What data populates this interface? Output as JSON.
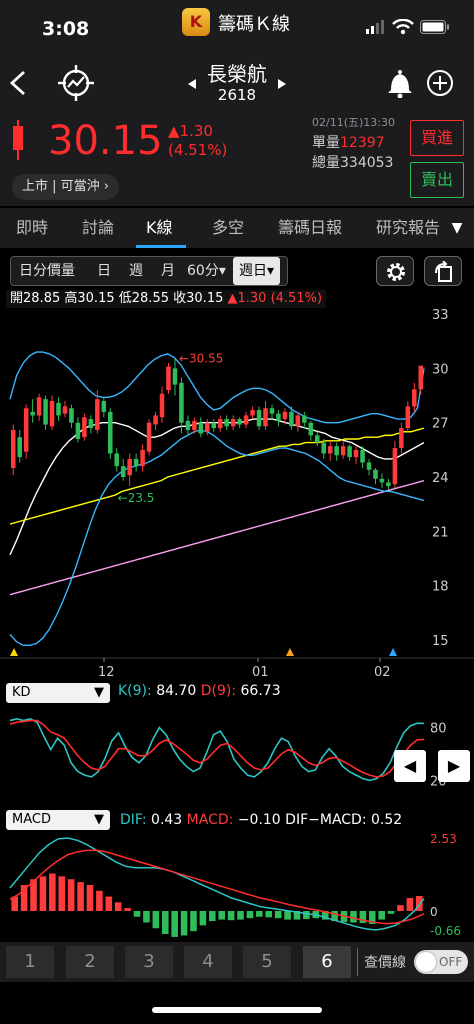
{
  "status_bar": {
    "time": "3:08",
    "app_logo": "K",
    "app_name": "籌碼Ｋ線"
  },
  "header": {
    "stock_name": "長榮航",
    "stock_code": "2618"
  },
  "quote": {
    "price": "30.15",
    "change": "▲1.30",
    "change_pct": "(4.51%)",
    "datetime": "02/11(五)13:30",
    "unit_volume_label": "單量",
    "unit_volume": "12397",
    "total_volume_label": "總量",
    "total_volume": "334053",
    "market_tag": "上市 | 可當沖 ›",
    "buy_label": "買進",
    "sell_label": "賣出"
  },
  "tabs": [
    "即時",
    "討論",
    "K線",
    "多空",
    "籌碼日報",
    "研究報告"
  ],
  "toolbar": {
    "items": [
      "日分價量",
      "日",
      "週",
      "月",
      "60分▾"
    ],
    "selected": "週日▾"
  },
  "ohlc": {
    "open_label": "開",
    "open": "28.85",
    "high_label": "高",
    "high": "30.15",
    "low_label": "低",
    "low": "28.55",
    "close_label": "收",
    "close": "30.15",
    "change": "▲1.30 (4.51%)"
  },
  "chart_data": {
    "type": "candlestick",
    "y_ticks": [
      "33",
      "30",
      "27",
      "24",
      "21",
      "18",
      "15"
    ],
    "x_ticks": [
      "12",
      "01",
      "02"
    ],
    "annotations": [
      "←30.55",
      "←23.5"
    ],
    "ylim": [
      14,
      34
    ],
    "candles": [
      [
        24.5,
        26.6,
        24.1,
        26.9
      ],
      [
        26.2,
        25.1,
        24.8,
        26.6
      ],
      [
        25.4,
        27.8,
        25.0,
        28.0
      ],
      [
        27.6,
        27.4,
        27.0,
        28.3
      ],
      [
        27.4,
        28.4,
        27.1,
        28.6
      ],
      [
        28.3,
        26.9,
        26.6,
        28.5
      ],
      [
        26.8,
        28.2,
        26.6,
        28.5
      ],
      [
        28.1,
        27.4,
        27.1,
        28.4
      ],
      [
        27.5,
        27.9,
        27.3,
        28.2
      ],
      [
        27.8,
        27.0,
        26.7,
        28.0
      ],
      [
        27.0,
        26.1,
        25.9,
        27.3
      ],
      [
        26.2,
        27.3,
        26.0,
        27.5
      ],
      [
        27.2,
        26.7,
        26.4,
        27.4
      ],
      [
        26.6,
        28.3,
        26.4,
        28.8
      ],
      [
        28.2,
        27.6,
        27.3,
        28.4
      ],
      [
        27.6,
        25.3,
        25.0,
        27.8
      ],
      [
        25.3,
        24.6,
        24.3,
        25.6
      ],
      [
        24.6,
        24.0,
        23.8,
        25.0
      ],
      [
        24.1,
        25.0,
        23.5,
        25.3
      ],
      [
        25.0,
        24.6,
        24.3,
        25.3
      ],
      [
        24.6,
        25.5,
        24.3,
        25.8
      ],
      [
        25.4,
        27.0,
        25.2,
        27.2
      ],
      [
        26.9,
        27.4,
        26.6,
        27.6
      ],
      [
        27.3,
        28.6,
        27.0,
        29.0
      ],
      [
        28.8,
        30.1,
        28.6,
        30.3
      ],
      [
        30.0,
        29.1,
        28.5,
        30.55
      ],
      [
        29.2,
        27.0,
        26.4,
        29.5
      ],
      [
        27.1,
        26.6,
        26.3,
        27.4
      ],
      [
        26.6,
        27.1,
        26.4,
        27.3
      ],
      [
        27.0,
        26.4,
        26.2,
        27.3
      ],
      [
        26.5,
        27.0,
        26.3,
        27.2
      ],
      [
        27.0,
        26.7,
        26.5,
        27.2
      ],
      [
        26.7,
        27.2,
        26.5,
        27.4
      ],
      [
        27.2,
        26.8,
        26.6,
        27.4
      ],
      [
        26.8,
        27.2,
        26.6,
        27.4
      ],
      [
        27.2,
        26.9,
        26.7,
        27.3
      ],
      [
        26.9,
        27.4,
        26.7,
        27.6
      ],
      [
        27.4,
        27.7,
        27.2,
        27.9
      ],
      [
        27.7,
        26.8,
        26.6,
        27.9
      ],
      [
        26.8,
        27.8,
        26.6,
        28.2
      ],
      [
        27.8,
        27.5,
        27.2,
        28.0
      ],
      [
        27.5,
        27.1,
        26.8,
        27.7
      ],
      [
        27.2,
        27.6,
        26.9,
        27.8
      ],
      [
        27.6,
        26.8,
        26.6,
        27.9
      ],
      [
        26.8,
        27.4,
        26.5,
        27.6
      ],
      [
        27.4,
        27.0,
        26.7,
        27.6
      ],
      [
        27.0,
        26.3,
        26.0,
        27.1
      ],
      [
        26.3,
        25.9,
        25.7,
        26.5
      ],
      [
        25.9,
        25.3,
        25.0,
        26.1
      ],
      [
        25.3,
        25.7,
        24.9,
        26.0
      ],
      [
        25.7,
        25.2,
        24.9,
        25.9
      ],
      [
        25.2,
        25.7,
        25.0,
        26.0
      ],
      [
        25.7,
        25.1,
        24.9,
        25.8
      ],
      [
        25.1,
        25.5,
        24.7,
        25.7
      ],
      [
        25.5,
        24.8,
        24.5,
        25.7
      ],
      [
        24.8,
        24.4,
        24.1,
        25.0
      ],
      [
        24.4,
        23.9,
        23.6,
        24.5
      ],
      [
        23.9,
        23.7,
        23.4,
        24.2
      ],
      [
        23.7,
        23.5,
        23.3,
        23.9
      ],
      [
        23.6,
        25.6,
        23.4,
        26.0
      ],
      [
        25.6,
        26.7,
        25.3,
        27.0
      ],
      [
        26.7,
        27.9,
        26.5,
        28.2
      ],
      [
        27.9,
        28.85,
        27.6,
        29.2
      ],
      [
        28.85,
        30.15,
        28.55,
        30.15
      ]
    ],
    "series": [
      {
        "color": "#ffffff",
        "values": [
          19.7,
          20.5,
          21.4,
          22.3,
          23.1,
          23.8,
          24.5,
          25.1,
          25.6,
          26.0,
          26.3,
          26.6,
          26.8,
          26.9,
          27.0,
          27.0,
          27.0,
          26.9,
          26.8,
          26.6,
          26.4,
          26.2,
          26.2,
          26.3,
          26.5,
          26.7,
          26.8,
          26.8,
          26.9,
          27.0,
          27.0,
          27.0,
          27.0,
          27.0,
          27.0,
          27.0,
          27.1,
          27.2,
          27.2,
          27.2,
          27.2,
          27.1,
          27.0,
          26.9,
          26.8,
          26.7,
          26.6,
          26.5,
          26.4,
          26.2,
          26.1,
          26.0,
          25.9,
          25.7,
          25.5,
          25.3,
          25.1,
          25.0,
          25.0,
          25.1,
          25.3,
          25.5,
          25.7,
          25.9
        ]
      },
      {
        "color": "#ffff00",
        "values": [
          21.4,
          21.5,
          21.6,
          21.7,
          21.8,
          21.9,
          22.0,
          22.1,
          22.2,
          22.3,
          22.4,
          22.5,
          22.6,
          22.7,
          22.8,
          22.9,
          23.0,
          23.2,
          23.3,
          23.4,
          23.5,
          23.6,
          23.7,
          23.8,
          24.0,
          24.1,
          24.2,
          24.3,
          24.4,
          24.5,
          24.6,
          24.7,
          24.8,
          24.9,
          25.0,
          25.1,
          25.2,
          25.3,
          25.4,
          25.5,
          25.6,
          25.7,
          25.7,
          25.8,
          25.8,
          25.9,
          25.9,
          25.9,
          26.0,
          26.0,
          26.0,
          26.1,
          26.1,
          26.1,
          26.2,
          26.2,
          26.2,
          26.3,
          26.3,
          26.4,
          26.5,
          26.5,
          26.6,
          26.7
        ]
      },
      {
        "color": "#ff9ff3",
        "values": [
          17.5,
          17.6,
          17.7,
          17.8,
          17.9,
          18.0,
          18.1,
          18.2,
          18.3,
          18.4,
          18.5,
          18.6,
          18.7,
          18.8,
          18.9,
          19.0,
          19.1,
          19.2,
          19.3,
          19.4,
          19.5,
          19.6,
          19.7,
          19.8,
          19.9,
          20.0,
          20.1,
          20.2,
          20.3,
          20.4,
          20.5,
          20.6,
          20.7,
          20.8,
          20.9,
          21.0,
          21.1,
          21.2,
          21.3,
          21.4,
          21.5,
          21.6,
          21.7,
          21.8,
          21.9,
          22.0,
          22.1,
          22.2,
          22.3,
          22.4,
          22.5,
          22.6,
          22.7,
          22.8,
          22.9,
          23.0,
          23.1,
          23.2,
          23.3,
          23.4,
          23.5,
          23.6,
          23.7,
          23.8
        ]
      },
      {
        "color": "#38b6ff",
        "values": [
          28.3,
          29.6,
          30.3,
          30.7,
          30.9,
          30.9,
          30.8,
          30.6,
          30.3,
          30.0,
          29.6,
          29.2,
          28.8,
          28.5,
          28.4,
          28.4,
          28.5,
          28.7,
          29.0,
          29.4,
          29.8,
          30.2,
          30.5,
          30.7,
          30.8,
          30.6,
          30.2,
          29.6,
          29.0,
          28.4,
          28.0,
          27.7,
          27.8,
          28.1,
          28.4,
          28.6,
          28.8,
          28.9,
          28.9,
          28.8,
          28.6,
          28.3,
          28.0,
          27.7,
          27.5,
          27.3,
          27.2,
          27.1,
          27.0,
          27.0,
          27.0,
          27.1,
          27.2,
          27.3,
          27.4,
          27.5,
          27.5,
          27.4,
          27.3,
          27.2,
          27.2,
          27.3,
          27.8,
          30.0
        ]
      },
      {
        "color": "#38b6ff",
        "values": [
          15.3,
          14.9,
          14.7,
          14.7,
          14.8,
          15.1,
          15.6,
          16.3,
          17.1,
          18.0,
          19.0,
          20.1,
          21.2,
          22.2,
          23.0,
          23.6,
          24.0,
          24.3,
          24.5,
          24.6,
          24.7,
          24.8,
          25.0,
          25.2,
          25.5,
          25.8,
          26.1,
          26.3,
          26.5,
          26.6,
          26.5,
          26.3,
          26.0,
          25.7,
          25.5,
          25.3,
          25.2,
          25.2,
          25.3,
          25.4,
          25.5,
          25.6,
          25.6,
          25.5,
          25.4,
          25.3,
          25.1,
          24.9,
          24.6,
          24.3,
          24.0,
          23.8,
          23.7,
          23.6,
          23.5,
          23.4,
          23.3,
          23.2,
          23.2,
          23.1,
          23.0,
          22.9,
          22.8,
          22.7
        ]
      }
    ]
  },
  "kd": {
    "select_label": "KD",
    "k_label": "K(9):",
    "k_value": "84.70",
    "d_label": "D(9):",
    "d_value": "66.73",
    "y_ticks": [
      "80",
      "20"
    ],
    "k_values": [
      88,
      90,
      88,
      90,
      86,
      70,
      55,
      68,
      60,
      40,
      30,
      26,
      24,
      30,
      45,
      65,
      74,
      58,
      46,
      40,
      48,
      66,
      80,
      72,
      56,
      44,
      36,
      30,
      34,
      52,
      72,
      76,
      64,
      44,
      34,
      26,
      24,
      30,
      40,
      56,
      68,
      64,
      48,
      36,
      30,
      32,
      46,
      56,
      48,
      36,
      30,
      26,
      22,
      20,
      22,
      28,
      40,
      58,
      74,
      82,
      85,
      84.7
    ],
    "d_values": [
      84,
      86,
      87,
      88,
      88,
      83,
      75,
      72,
      68,
      58,
      48,
      40,
      34,
      32,
      36,
      46,
      56,
      56,
      52,
      48,
      48,
      54,
      62,
      66,
      62,
      56,
      50,
      43,
      40,
      44,
      52,
      60,
      62,
      56,
      48,
      40,
      34,
      32,
      34,
      42,
      50,
      55,
      52,
      46,
      40,
      37,
      40,
      45,
      46,
      42,
      38,
      33,
      29,
      26,
      24,
      25,
      30,
      40,
      50,
      60,
      66,
      66.73
    ]
  },
  "macd": {
    "select_label": "MACD",
    "dif_label": "DIF:",
    "dif_value": "0.43",
    "macd_label": "MACD:",
    "macd_value": "−0.10",
    "osc_label": "DIF−MACD:",
    "osc_value": "0.52",
    "y_ticks": [
      "2.53",
      "0",
      "-0.66"
    ],
    "dif_values": [
      0.8,
      1.2,
      1.6,
      2.0,
      2.3,
      2.5,
      2.53,
      2.45,
      2.3,
      2.1,
      1.9,
      1.7,
      1.55,
      1.5,
      1.5,
      1.5,
      1.45,
      1.35,
      1.2,
      1.05,
      0.9,
      0.75,
      0.6,
      0.45,
      0.35,
      0.25,
      0.15,
      0.1,
      0.05,
      0.0,
      -0.05,
      -0.1,
      -0.15,
      -0.25,
      -0.35,
      -0.45,
      -0.55,
      -0.62,
      -0.66,
      -0.6,
      -0.5,
      -0.3,
      0.0,
      0.43
    ],
    "macd_values": [
      0.4,
      0.6,
      0.9,
      1.2,
      1.5,
      1.75,
      1.95,
      2.05,
      2.1,
      2.1,
      2.05,
      1.95,
      1.85,
      1.75,
      1.65,
      1.55,
      1.45,
      1.35,
      1.25,
      1.15,
      1.05,
      0.95,
      0.85,
      0.75,
      0.65,
      0.55,
      0.45,
      0.38,
      0.3,
      0.22,
      0.15,
      0.08,
      0.02,
      -0.05,
      -0.12,
      -0.2,
      -0.27,
      -0.34,
      -0.4,
      -0.44,
      -0.42,
      -0.35,
      -0.25,
      -0.1
    ],
    "osc_values": [
      0.5,
      0.9,
      1.1,
      1.2,
      1.3,
      1.2,
      1.1,
      1.0,
      0.9,
      0.7,
      0.5,
      0.3,
      0.1,
      -0.2,
      -0.4,
      -0.6,
      -0.8,
      -0.9,
      -0.85,
      -0.7,
      -0.5,
      -0.35,
      -0.3,
      -0.32,
      -0.3,
      -0.25,
      -0.2,
      -0.22,
      -0.25,
      -0.3,
      -0.3,
      -0.28,
      -0.25,
      -0.3,
      -0.35,
      -0.38,
      -0.4,
      -0.42,
      -0.45,
      -0.3,
      -0.1,
      0.2,
      0.45,
      0.52
    ]
  },
  "number_bar": {
    "items": [
      "1",
      "2",
      "3",
      "4",
      "5",
      "6"
    ],
    "selected": "6",
    "price_line_label": "查價線",
    "toggle_label": "OFF"
  }
}
